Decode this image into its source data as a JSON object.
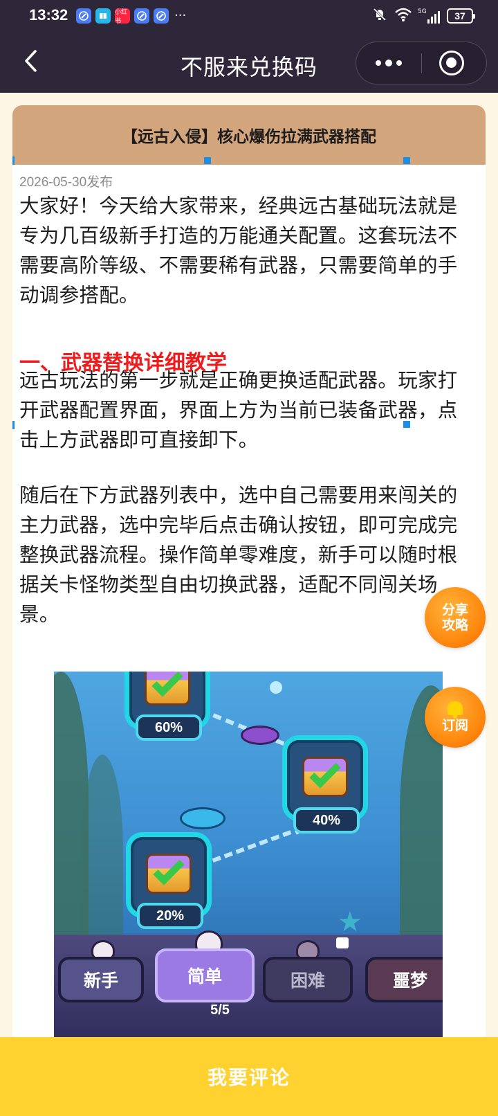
{
  "status_bar": {
    "time": "13:32",
    "app_icons": [
      {
        "name": "browser-icon",
        "color": "#4a7cf6",
        "label": ""
      },
      {
        "name": "reader-icon",
        "color": "#27b6e8",
        "label": ""
      },
      {
        "name": "xiaohongshu-icon",
        "color": "#ff2442",
        "label": "小红书"
      },
      {
        "name": "browser-icon",
        "color": "#4a7cf6",
        "label": ""
      },
      {
        "name": "browser-icon",
        "color": "#4a7cf6",
        "label": ""
      }
    ],
    "more_indicator": "···",
    "network": "5G",
    "battery": "37"
  },
  "navbar": {
    "title": "不服来兑换码"
  },
  "article": {
    "title": "【远古入侵】核心爆伤拉满武器搭配",
    "publish_date": "2026-05-30发布",
    "intro": "大家好！今天给大家带来，经典远古基础玩法就是专为几百级新手打造的万能通关配置。这套玩法不需要高阶等级、不需要稀有武器，只需要简单的手动调参搭配。",
    "section_heading": "一、武器替换详细教学",
    "para1": "远古玩法的第一步就是正确更换适配武器。玩家打开武器配置界面，界面上方为当前已装备武器，点击上方武器即可直接卸下。",
    "para2": "随后在下方武器列表中，选中自己需要用来闯关的主力武器，选中完毕后点击确认按钮，即可完成完整换武器流程。操作简单零难度，新手可以随时根据关卡怪物类型自由切换武器，适配不同闯关场景。"
  },
  "game_image": {
    "nodes": [
      {
        "progress": "60%"
      },
      {
        "progress": "40%"
      },
      {
        "progress": "20%"
      }
    ],
    "difficulties": [
      {
        "label": "新手",
        "state": "normal"
      },
      {
        "label": "简单",
        "state": "active"
      },
      {
        "label": "困难",
        "state": "locked"
      },
      {
        "label": "噩梦",
        "state": "normal"
      }
    ],
    "current_progress": "5/5"
  },
  "floating": {
    "share_line1": "分享",
    "share_line2": "攻略",
    "subscribe": "订阅"
  },
  "bottom_bar": {
    "comment_label": "我要评论"
  },
  "colors": {
    "topbar": "#2e2639",
    "card_header": "#d3a57c",
    "heading_red": "#ee1c1c",
    "float_orange": "#ff8a10",
    "comment_yellow": "#ffd22f"
  }
}
